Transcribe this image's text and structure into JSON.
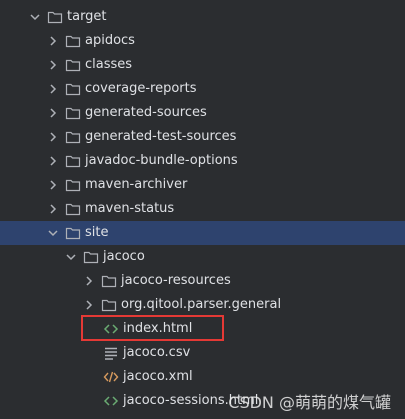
{
  "tree": {
    "root": {
      "label": "target",
      "expanded": true
    },
    "folders": [
      {
        "label": "apidocs"
      },
      {
        "label": "classes"
      },
      {
        "label": "coverage-reports"
      },
      {
        "label": "generated-sources"
      },
      {
        "label": "generated-test-sources"
      },
      {
        "label": "javadoc-bundle-options"
      },
      {
        "label": "maven-archiver"
      },
      {
        "label": "maven-status"
      }
    ],
    "site": {
      "label": "site",
      "expanded": true,
      "selected": true
    },
    "jacoco": {
      "label": "jacoco",
      "expanded": true
    },
    "jacoco_children": [
      {
        "label": "jacoco-resources",
        "type": "folder"
      },
      {
        "label": "org.qitool.parser.general",
        "type": "folder"
      }
    ],
    "files": [
      {
        "label": "index.html",
        "type": "html",
        "icon": "html-file-icon",
        "highlighted": true
      },
      {
        "label": "jacoco.csv",
        "type": "text",
        "icon": "text-file-icon"
      },
      {
        "label": "jacoco.xml",
        "type": "xml",
        "icon": "xml-file-icon"
      },
      {
        "label": "jacoco-sessions.html",
        "type": "html",
        "icon": "html-file-icon"
      }
    ]
  },
  "colors": {
    "background": "#2b2d30",
    "selection": "#2e436e",
    "text": "#dfe1e5",
    "folder_icon": "#aeb1b7",
    "html_icon": "#6aab73",
    "xml_icon": "#d69a5e",
    "highlight_border": "#e53935"
  },
  "watermark": "CSDN @萌萌的煤气罐"
}
